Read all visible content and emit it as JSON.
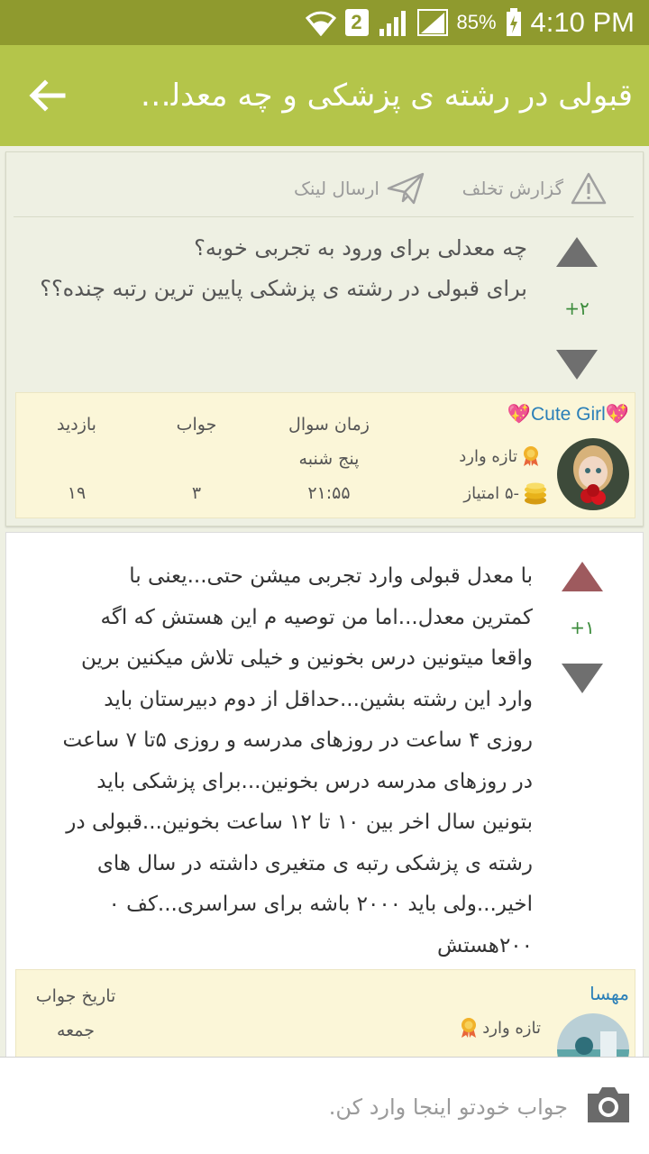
{
  "status_bar": {
    "time": "4:10 PM",
    "battery_percent": "85%",
    "sim_slot": "2"
  },
  "app_bar": {
    "title": "قبولی در رشته ی پزشکی و چه معدلی خ..."
  },
  "question": {
    "actions": {
      "report_label": "گزارش تخلف",
      "share_label": "ارسال لینک"
    },
    "lines": [
      "چه معدلی برای ورود به تجربی خوبه؟",
      "برای قبولی در رشته ی پزشکی پایین ترین رتبه چنده؟؟"
    ],
    "score": "+۲",
    "author": {
      "name": "💖Cute Girl💖",
      "rank": "تازه وارد",
      "points": "-۵ امتیاز"
    },
    "stats": {
      "time_label": "زمان سوال",
      "day": "پنج شنبه",
      "time_value": "۲۱:۵۵",
      "answers_label": "جواب",
      "answers_value": "۳",
      "views_label": "بازدید",
      "views_value": "۱۹"
    }
  },
  "answer": {
    "score": "+۱",
    "lines": [
      "با معدل قبولی وارد تجربی میشن حتی...یعنی با",
      "کمترین معدل...اما من توصیه م این هستش که اگه",
      "واقعا میتونین درس بخونین و خیلی تلاش میکنین برین",
      "وارد این رشته بشین...حداقل از دوم دبیرستان باید",
      "روزی ۴ ساعت در روزهای مدرسه و روزی ۵تا ۷ ساعت",
      "در روزهای مدرسه درس بخونین...برای پزشکی باید",
      "بتونین سال اخر بین ۱۰ تا ۱۲ ساعت بخونین...قبولی در",
      "رشته ی پزشکی رتبه ی متغیری داشته در سال های",
      "اخیر...ولی باید ۲۰۰۰ باشه برای سراسری...کف ۰",
      "۲۰۰هستش"
    ],
    "author": {
      "name": "مهسا",
      "rank": "تازه وارد"
    },
    "date_label": "تاریخ جواب",
    "day": "جمعه"
  },
  "input": {
    "placeholder": "جواب خودتو اینجا وارد کن."
  },
  "colors": {
    "status_bar": "#8f9a2e",
    "app_bar": "#b4c54a",
    "vote_arrow": "#6f6f6f",
    "upvoted_arrow": "#9e5a5e",
    "score": "#3c8c3c",
    "author_name": "#2a7fb8",
    "info_panel": "#fbf6d8"
  },
  "icons": {
    "back": "arrow-left-icon",
    "report": "warning-icon",
    "share": "paper-plane-icon",
    "rank": "medal-icon",
    "points": "coins-icon",
    "camera": "camera-icon"
  }
}
